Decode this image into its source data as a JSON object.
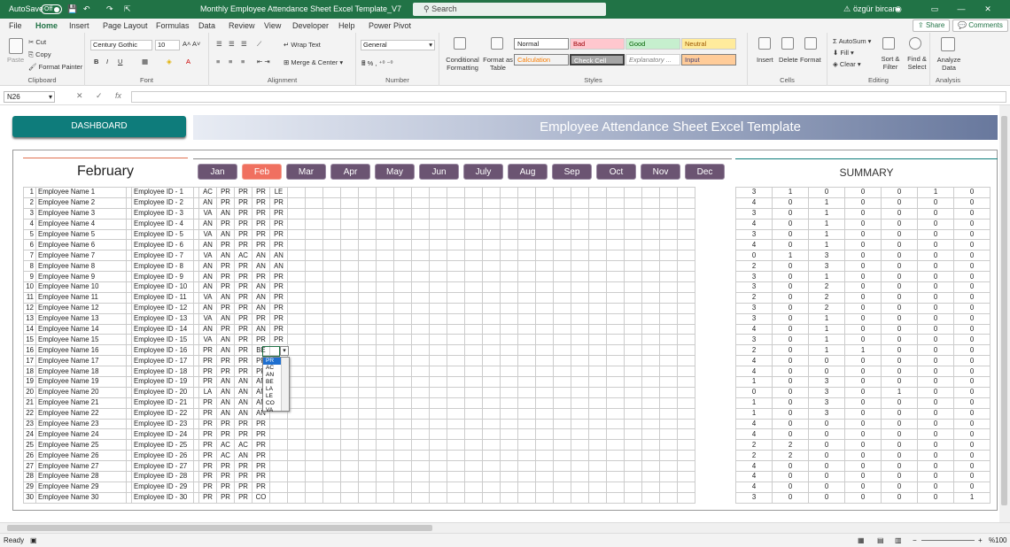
{
  "titlebar": {
    "autosave": "AutoSave",
    "autosave_state": "Off",
    "doc_title": "Monthly Employee Attendance Sheet Excel Template_V7",
    "search": "Search",
    "user": "özgür bircan"
  },
  "menu": {
    "items": [
      "File",
      "Home",
      "Insert",
      "Page Layout",
      "Formulas",
      "Data",
      "Review",
      "View",
      "Developer",
      "Help",
      "Power Pivot"
    ],
    "active": "Home",
    "share": "Share",
    "comments": "Comments"
  },
  "ribbon": {
    "clipboard": {
      "label": "Clipboard",
      "paste": "Paste",
      "cut": "Cut",
      "copy": "Copy",
      "format_painter": "Format Painter"
    },
    "font": {
      "label": "Font",
      "name": "Century Gothic",
      "size": "10"
    },
    "alignment": {
      "label": "Alignment",
      "wrap": "Wrap Text",
      "merge": "Merge & Center"
    },
    "number": {
      "label": "Number",
      "format": "General"
    },
    "styles": {
      "label": "Styles",
      "cond": "Conditional Formatting",
      "table": "Format as Table",
      "normal": "Normal",
      "bad": "Bad",
      "good": "Good",
      "neutral": "Neutral",
      "calculation": "Calculation",
      "check": "Check Cell",
      "explanatory": "Explanatory ...",
      "input": "Input"
    },
    "cells": {
      "label": "Cells",
      "insert": "Insert",
      "delete": "Delete",
      "format": "Format"
    },
    "editing": {
      "label": "Editing",
      "autosum": "AutoSum",
      "fill": "Fill",
      "clear": "Clear",
      "sort": "Sort & Filter",
      "find": "Find & Select"
    },
    "analysis": {
      "label": "Analysis",
      "analyze": "Analyze Data"
    }
  },
  "formula": {
    "namebox": "N26",
    "fx": "fx"
  },
  "sheet": {
    "dashboard": "DASHBOARD",
    "banner": "Employee Attendance Sheet Excel Template",
    "month": "February",
    "months": [
      "Jan",
      "Feb",
      "Mar",
      "Apr",
      "May",
      "Jun",
      "July",
      "Aug",
      "Sep",
      "Oct",
      "Nov",
      "Dec"
    ],
    "selected_month": "Feb",
    "summary": "SUMMARY",
    "rows": [
      {
        "n": "1",
        "name": "Employee Name 1",
        "id": "Employee ID - 1",
        "d": [
          "AC",
          "PR",
          "PR",
          "PR",
          "LE"
        ]
      },
      {
        "n": "2",
        "name": "Employee Name 2",
        "id": "Employee ID - 2",
        "d": [
          "AN",
          "PR",
          "PR",
          "PR",
          "PR"
        ]
      },
      {
        "n": "3",
        "name": "Employee Name 3",
        "id": "Employee ID - 3",
        "d": [
          "VA",
          "AN",
          "PR",
          "PR",
          "PR"
        ]
      },
      {
        "n": "4",
        "name": "Employee Name 4",
        "id": "Employee ID - 4",
        "d": [
          "AN",
          "PR",
          "PR",
          "PR",
          "PR"
        ]
      },
      {
        "n": "5",
        "name": "Employee Name 5",
        "id": "Employee ID - 5",
        "d": [
          "VA",
          "AN",
          "PR",
          "PR",
          "PR"
        ]
      },
      {
        "n": "6",
        "name": "Employee Name 6",
        "id": "Employee ID - 6",
        "d": [
          "AN",
          "PR",
          "PR",
          "PR",
          "PR"
        ]
      },
      {
        "n": "7",
        "name": "Employee Name 7",
        "id": "Employee ID - 7",
        "d": [
          "VA",
          "AN",
          "AC",
          "AN",
          "AN"
        ]
      },
      {
        "n": "8",
        "name": "Employee Name 8",
        "id": "Employee ID - 8",
        "d": [
          "AN",
          "PR",
          "PR",
          "AN",
          "AN"
        ]
      },
      {
        "n": "9",
        "name": "Employee Name 9",
        "id": "Employee ID - 9",
        "d": [
          "AN",
          "PR",
          "PR",
          "PR",
          "PR"
        ]
      },
      {
        "n": "10",
        "name": "Employee Name 10",
        "id": "Employee ID - 10",
        "d": [
          "AN",
          "PR",
          "PR",
          "AN",
          "PR"
        ]
      },
      {
        "n": "11",
        "name": "Employee Name 11",
        "id": "Employee ID - 11",
        "d": [
          "VA",
          "AN",
          "PR",
          "AN",
          "PR"
        ]
      },
      {
        "n": "12",
        "name": "Employee Name 12",
        "id": "Employee ID - 12",
        "d": [
          "AN",
          "PR",
          "PR",
          "AN",
          "PR"
        ]
      },
      {
        "n": "13",
        "name": "Employee Name 13",
        "id": "Employee ID - 13",
        "d": [
          "VA",
          "AN",
          "PR",
          "PR",
          "PR"
        ]
      },
      {
        "n": "14",
        "name": "Employee Name 14",
        "id": "Employee ID - 14",
        "d": [
          "AN",
          "PR",
          "PR",
          "AN",
          "PR"
        ]
      },
      {
        "n": "15",
        "name": "Employee Name 15",
        "id": "Employee ID - 15",
        "d": [
          "VA",
          "AN",
          "PR",
          "PR",
          "PR"
        ]
      },
      {
        "n": "16",
        "name": "Employee Name 16",
        "id": "Employee ID - 16",
        "d": [
          "PR",
          "AN",
          "PR",
          "BE",
          ""
        ]
      },
      {
        "n": "17",
        "name": "Employee Name 17",
        "id": "Employee ID - 17",
        "d": [
          "PR",
          "PR",
          "PR",
          "PR",
          ""
        ]
      },
      {
        "n": "18",
        "name": "Employee Name 18",
        "id": "Employee ID - 18",
        "d": [
          "PR",
          "PR",
          "PR",
          "PR",
          ""
        ]
      },
      {
        "n": "19",
        "name": "Employee Name 19",
        "id": "Employee ID - 19",
        "d": [
          "PR",
          "AN",
          "AN",
          "AN",
          ""
        ]
      },
      {
        "n": "20",
        "name": "Employee Name 20",
        "id": "Employee ID - 20",
        "d": [
          "LA",
          "AN",
          "AN",
          "AN",
          ""
        ]
      },
      {
        "n": "21",
        "name": "Employee Name 21",
        "id": "Employee ID - 21",
        "d": [
          "PR",
          "AN",
          "AN",
          "AN",
          ""
        ]
      },
      {
        "n": "22",
        "name": "Employee Name 22",
        "id": "Employee ID - 22",
        "d": [
          "PR",
          "AN",
          "AN",
          "AN",
          ""
        ]
      },
      {
        "n": "23",
        "name": "Employee Name 23",
        "id": "Employee ID - 23",
        "d": [
          "PR",
          "PR",
          "PR",
          "PR",
          ""
        ]
      },
      {
        "n": "24",
        "name": "Employee Name 24",
        "id": "Employee ID - 24",
        "d": [
          "PR",
          "PR",
          "PR",
          "PR",
          ""
        ]
      },
      {
        "n": "25",
        "name": "Employee Name 25",
        "id": "Employee ID - 25",
        "d": [
          "PR",
          "AC",
          "AC",
          "PR",
          ""
        ]
      },
      {
        "n": "26",
        "name": "Employee Name 26",
        "id": "Employee ID - 26",
        "d": [
          "PR",
          "AC",
          "AN",
          "PR",
          ""
        ]
      },
      {
        "n": "27",
        "name": "Employee Name 27",
        "id": "Employee ID - 27",
        "d": [
          "PR",
          "PR",
          "PR",
          "PR",
          ""
        ]
      },
      {
        "n": "28",
        "name": "Employee Name 28",
        "id": "Employee ID - 28",
        "d": [
          "PR",
          "PR",
          "PR",
          "PR",
          ""
        ]
      },
      {
        "n": "29",
        "name": "Employee Name 29",
        "id": "Employee ID - 29",
        "d": [
          "PR",
          "PR",
          "PR",
          "PR",
          ""
        ]
      },
      {
        "n": "30",
        "name": "Employee Name 30",
        "id": "Employee ID - 30",
        "d": [
          "PR",
          "PR",
          "PR",
          "CO",
          ""
        ]
      }
    ],
    "summary_rows": [
      [
        "3",
        "1",
        "0",
        "0",
        "0",
        "1",
        "0"
      ],
      [
        "4",
        "0",
        "1",
        "0",
        "0",
        "0",
        "0"
      ],
      [
        "3",
        "0",
        "1",
        "0",
        "0",
        "0",
        "0"
      ],
      [
        "4",
        "0",
        "1",
        "0",
        "0",
        "0",
        "0"
      ],
      [
        "3",
        "0",
        "1",
        "0",
        "0",
        "0",
        "0"
      ],
      [
        "4",
        "0",
        "1",
        "0",
        "0",
        "0",
        "0"
      ],
      [
        "0",
        "1",
        "3",
        "0",
        "0",
        "0",
        "0"
      ],
      [
        "2",
        "0",
        "3",
        "0",
        "0",
        "0",
        "0"
      ],
      [
        "3",
        "0",
        "1",
        "0",
        "0",
        "0",
        "0"
      ],
      [
        "3",
        "0",
        "2",
        "0",
        "0",
        "0",
        "0"
      ],
      [
        "2",
        "0",
        "2",
        "0",
        "0",
        "0",
        "0"
      ],
      [
        "3",
        "0",
        "2",
        "0",
        "0",
        "0",
        "0"
      ],
      [
        "3",
        "0",
        "1",
        "0",
        "0",
        "0",
        "0"
      ],
      [
        "4",
        "0",
        "1",
        "0",
        "0",
        "0",
        "0"
      ],
      [
        "3",
        "0",
        "1",
        "0",
        "0",
        "0",
        "0"
      ],
      [
        "2",
        "0",
        "1",
        "1",
        "0",
        "0",
        "0"
      ],
      [
        "4",
        "0",
        "0",
        "0",
        "0",
        "0",
        "0"
      ],
      [
        "4",
        "0",
        "0",
        "0",
        "0",
        "0",
        "0"
      ],
      [
        "1",
        "0",
        "3",
        "0",
        "0",
        "0",
        "0"
      ],
      [
        "0",
        "0",
        "3",
        "0",
        "1",
        "0",
        "0"
      ],
      [
        "1",
        "0",
        "3",
        "0",
        "0",
        "0",
        "0"
      ],
      [
        "1",
        "0",
        "3",
        "0",
        "0",
        "0",
        "0"
      ],
      [
        "4",
        "0",
        "0",
        "0",
        "0",
        "0",
        "0"
      ],
      [
        "4",
        "0",
        "0",
        "0",
        "0",
        "0",
        "0"
      ],
      [
        "2",
        "2",
        "0",
        "0",
        "0",
        "0",
        "0"
      ],
      [
        "2",
        "2",
        "0",
        "0",
        "0",
        "0",
        "0"
      ],
      [
        "4",
        "0",
        "0",
        "0",
        "0",
        "0",
        "0"
      ],
      [
        "4",
        "0",
        "0",
        "0",
        "0",
        "0",
        "0"
      ],
      [
        "4",
        "0",
        "0",
        "0",
        "0",
        "0",
        "0"
      ],
      [
        "3",
        "0",
        "0",
        "0",
        "0",
        "0",
        "1"
      ]
    ],
    "dropdown": [
      "PR",
      "AC",
      "AN",
      "BE",
      "LA",
      "LE",
      "CO",
      "VA"
    ]
  },
  "status": {
    "ready": "Ready",
    "zoom": "%100"
  }
}
